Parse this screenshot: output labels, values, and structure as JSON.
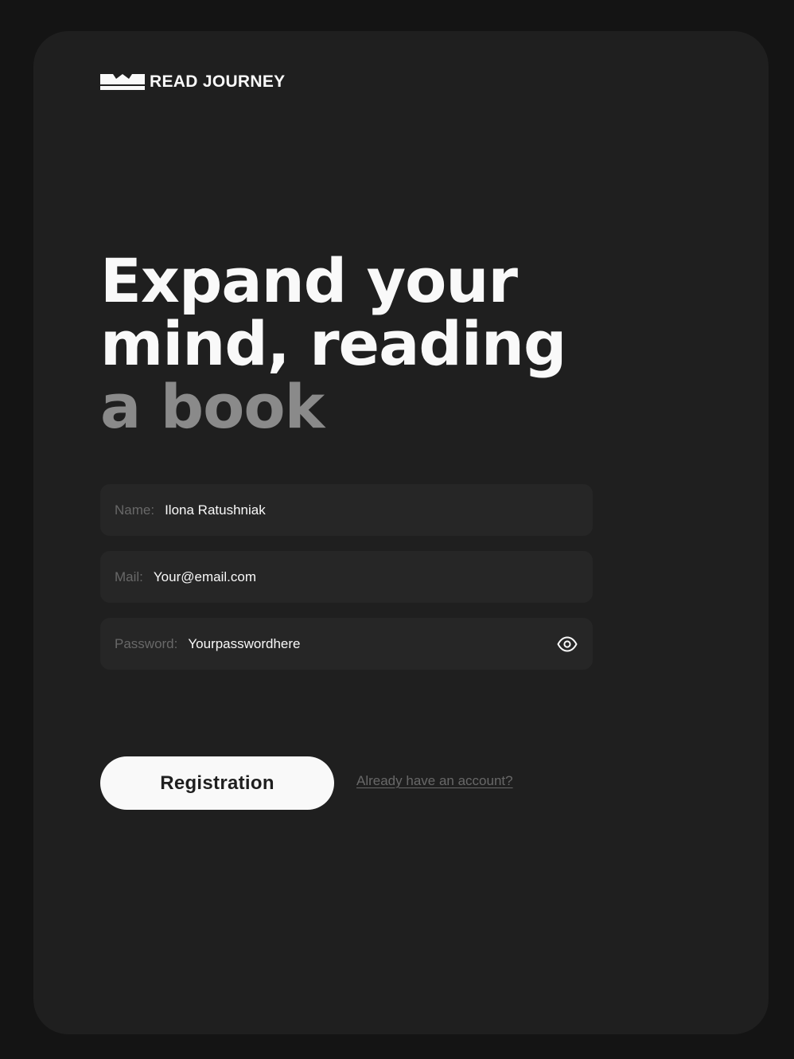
{
  "logo": {
    "text": "READ JOURNEY",
    "icon": "open-book-icon"
  },
  "hero": {
    "line1": "Expand your",
    "line2": "mind, reading",
    "line3_accent": "a book"
  },
  "form": {
    "name": {
      "label": "Name:",
      "value": "Ilona Ratushniak"
    },
    "mail": {
      "label": "Mail:",
      "value": "Your@email.com"
    },
    "password": {
      "label": "Password:",
      "value": "Yourpasswordhere",
      "toggle_icon": "eye-icon"
    }
  },
  "actions": {
    "register_label": "Registration",
    "login_link": "Already have an account?"
  },
  "colors": {
    "page_bg": "#141414",
    "card_bg": "#1f1f1f",
    "field_bg": "#262626",
    "text_primary": "#f9f9f9",
    "text_muted": "#686868",
    "accent_gray": "#8a8a8a"
  }
}
